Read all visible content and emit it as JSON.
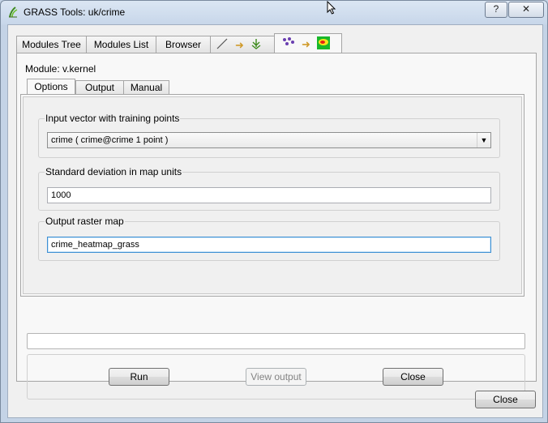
{
  "window": {
    "title": "GRASS Tools: uk/crime",
    "help_glyph": "?",
    "close_glyph": "✕"
  },
  "tabs": {
    "modules_tree": "Modules Tree",
    "modules_list": "Modules List",
    "browser": "Browser",
    "arrow_glyph": "➜"
  },
  "module": {
    "label": "Module: v.kernel",
    "subtabs": {
      "options": "Options",
      "output": "Output",
      "manual": "Manual"
    }
  },
  "options": {
    "input_vector": {
      "title": "Input vector with training points",
      "value": "crime ( crime@crime 1 point )",
      "arrow": "▼"
    },
    "std_dev": {
      "title": "Standard deviation in map units",
      "value": "1000"
    },
    "output_raster": {
      "title": "Output raster map",
      "value": "crime_heatmap_grass"
    }
  },
  "actions": {
    "run": "Run",
    "view_output": "View output",
    "close_inner": "Close"
  },
  "footer": {
    "close": "Close"
  },
  "colors": {
    "titlebar": "#c4d3e6",
    "focus": "#3c8fd3",
    "arrow": "#d09b2c"
  }
}
